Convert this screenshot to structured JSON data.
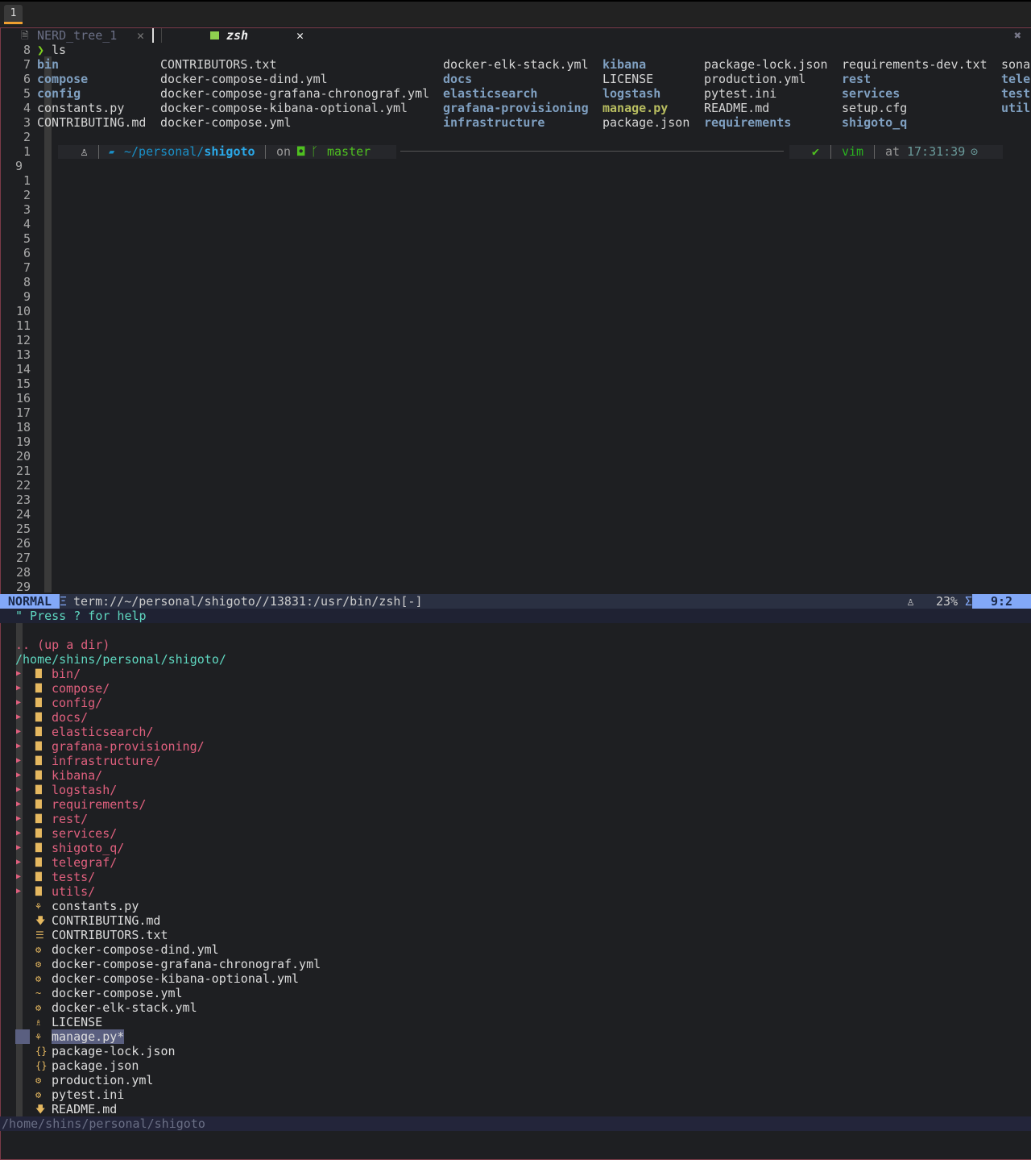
{
  "workspace": {
    "tab": "1"
  },
  "tabs": [
    {
      "label": "NERD_tree_1",
      "icon": "file-icon"
    },
    {
      "label": "zsh",
      "icon": "terminal-icon"
    }
  ],
  "terminal": {
    "prompt_line": {
      "num": "8",
      "symbol": "❯",
      "command": "ls"
    },
    "ls_columns": [
      [
        {
          "t": "bin",
          "k": "dir"
        },
        {
          "t": "compose",
          "k": "dir"
        },
        {
          "t": "config",
          "k": "dir"
        },
        {
          "t": "constants.py",
          "k": "file"
        },
        {
          "t": "CONTRIBUTING.md",
          "k": "file"
        }
      ],
      [
        {
          "t": "CONTRIBUTORS.txt",
          "k": "file"
        },
        {
          "t": "docker-compose-dind.yml",
          "k": "file"
        },
        {
          "t": "docker-compose-grafana-chronograf.yml",
          "k": "file"
        },
        {
          "t": "docker-compose-kibana-optional.yml",
          "k": "file"
        },
        {
          "t": "docker-compose.yml",
          "k": "file"
        }
      ],
      [
        {
          "t": "docker-elk-stack.yml",
          "k": "file"
        },
        {
          "t": "docs",
          "k": "dir"
        },
        {
          "t": "elasticsearch",
          "k": "dir"
        },
        {
          "t": "grafana-provisioning",
          "k": "dir"
        },
        {
          "t": "infrastructure",
          "k": "dir"
        }
      ],
      [
        {
          "t": "kibana",
          "k": "dir"
        },
        {
          "t": "LICENSE",
          "k": "file"
        },
        {
          "t": "logstash",
          "k": "dir"
        },
        {
          "t": "manage.py",
          "k": "exe"
        },
        {
          "t": "package.json",
          "k": "file"
        }
      ],
      [
        {
          "t": "package-lock.json",
          "k": "file"
        },
        {
          "t": "production.yml",
          "k": "file"
        },
        {
          "t": "pytest.ini",
          "k": "file"
        },
        {
          "t": "README.md",
          "k": "file"
        },
        {
          "t": "requirements",
          "k": "dir"
        }
      ],
      [
        {
          "t": "requirements-dev.txt",
          "k": "file"
        },
        {
          "t": "rest",
          "k": "dir"
        },
        {
          "t": "services",
          "k": "dir"
        },
        {
          "t": "setup.cfg",
          "k": "file"
        },
        {
          "t": "shigoto_q",
          "k": "dir"
        }
      ],
      [
        {
          "t": "sona",
          "k": "file"
        },
        {
          "t": "tele",
          "k": "dir"
        },
        {
          "t": "test",
          "k": "dir"
        },
        {
          "t": "util",
          "k": "dir"
        }
      ]
    ],
    "ls_line_numbers": [
      "7",
      "6",
      "5",
      "4",
      "3",
      "2",
      "1"
    ],
    "prompt": {
      "path_prefix": "~/personal/",
      "path_dir": "shigoto",
      "on": "on",
      "branch": "master",
      "check": "✔",
      "vim": "vim",
      "at": "at",
      "time": "17:31:39"
    },
    "cursor_line": "9",
    "line_numbers": [
      "1",
      "2",
      "3",
      "4",
      "5",
      "6",
      "7",
      "8",
      "9",
      "10",
      "11",
      "12",
      "13",
      "14",
      "15",
      "16",
      "17",
      "18",
      "19",
      "20",
      "21",
      "22",
      "23",
      "24",
      "25",
      "26",
      "27",
      "28",
      "29"
    ]
  },
  "statusline": {
    "mode": "NORMAL",
    "file": "term://~/personal/shigoto//13831:/usr/bin/zsh[-]",
    "percent": "23%",
    "position": "9:2"
  },
  "nerdtree": {
    "help": "\" Press ? for help",
    "up": ".. (up a dir)",
    "root": "/home/shins/personal/shigoto/",
    "dirs": [
      "bin/",
      "compose/",
      "config/",
      "docs/",
      "elasticsearch/",
      "grafana-provisioning/",
      "infrastructure/",
      "kibana/",
      "logstash/",
      "requirements/",
      "rest/",
      "services/",
      "shigoto_q/",
      "telegraf/",
      "tests/",
      "utils/"
    ],
    "files": [
      {
        "t": "constants.py",
        "i": "python-icon",
        "g": "⚘"
      },
      {
        "t": "CONTRIBUTING.md",
        "i": "markdown-icon",
        "g": "🡇"
      },
      {
        "t": "CONTRIBUTORS.txt",
        "i": "text-icon",
        "g": "☰"
      },
      {
        "t": "docker-compose-dind.yml",
        "i": "gear-icon",
        "g": "⚙"
      },
      {
        "t": "docker-compose-grafana-chronograf.yml",
        "i": "gear-icon",
        "g": "⚙"
      },
      {
        "t": "docker-compose-kibana-optional.yml",
        "i": "gear-icon",
        "g": "⚙"
      },
      {
        "t": "docker-compose.yml",
        "i": "docker-icon",
        "g": "~"
      },
      {
        "t": "docker-elk-stack.yml",
        "i": "gear-icon",
        "g": "⚙"
      },
      {
        "t": "LICENSE",
        "i": "license-icon",
        "g": "♗"
      },
      {
        "t": "manage.py*",
        "i": "python-icon",
        "g": "⚘",
        "selected": true
      },
      {
        "t": "package-lock.json",
        "i": "json-icon",
        "g": "{}"
      },
      {
        "t": "package.json",
        "i": "json-icon",
        "g": "{}"
      },
      {
        "t": "production.yml",
        "i": "gear-icon",
        "g": "⚙"
      },
      {
        "t": "pytest.ini",
        "i": "gear-icon",
        "g": "⚙"
      },
      {
        "t": "README.md",
        "i": "markdown-icon",
        "g": "🡇"
      }
    ]
  },
  "cmdline": "/home/shins/personal/shigoto"
}
